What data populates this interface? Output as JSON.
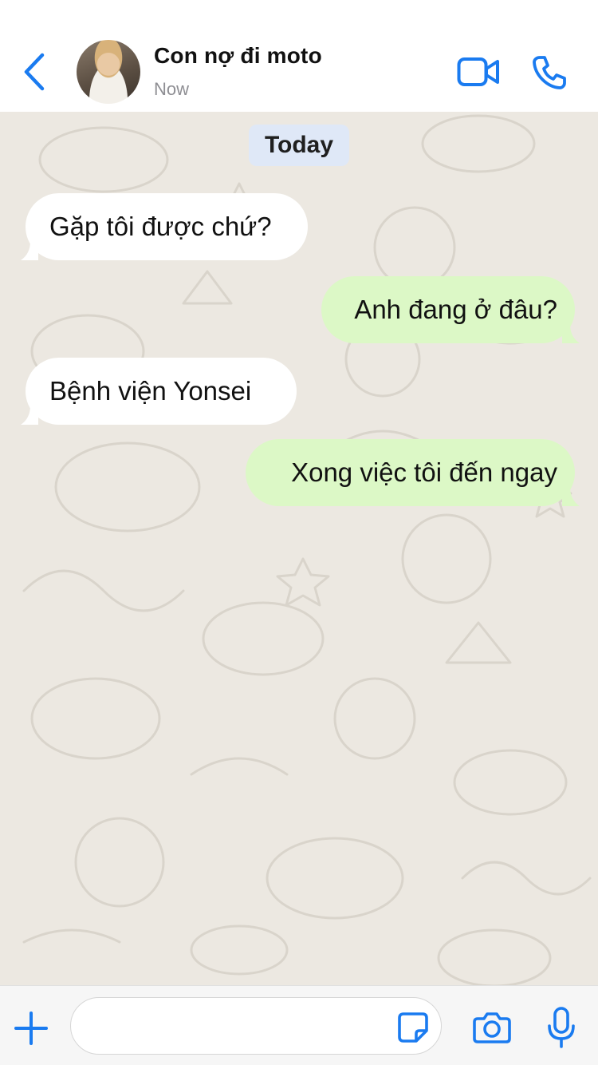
{
  "header": {
    "contact_name": "Con nợ đi moto",
    "status": "Now",
    "icons": {
      "back": "chevron-left-icon",
      "video": "video-camera-icon",
      "call": "phone-icon"
    },
    "accent_color": "#1a7bf0"
  },
  "chat": {
    "date_label": "Today",
    "background_color": "#ece8e1",
    "incoming_bubble_color": "#ffffff",
    "outgoing_bubble_color": "#dcf8c6",
    "messages": [
      {
        "direction": "incoming",
        "text": "Gặp tôi được chứ?"
      },
      {
        "direction": "outgoing",
        "text": "Anh đang ở đâu?"
      },
      {
        "direction": "incoming",
        "text": "Bệnh viện Yonsei"
      },
      {
        "direction": "outgoing",
        "text": "Xong việc tôi đến ngay"
      }
    ]
  },
  "input_bar": {
    "value": "",
    "icons": {
      "add": "plus-icon",
      "sticker": "sticker-icon",
      "camera": "camera-icon",
      "mic": "microphone-icon"
    }
  }
}
